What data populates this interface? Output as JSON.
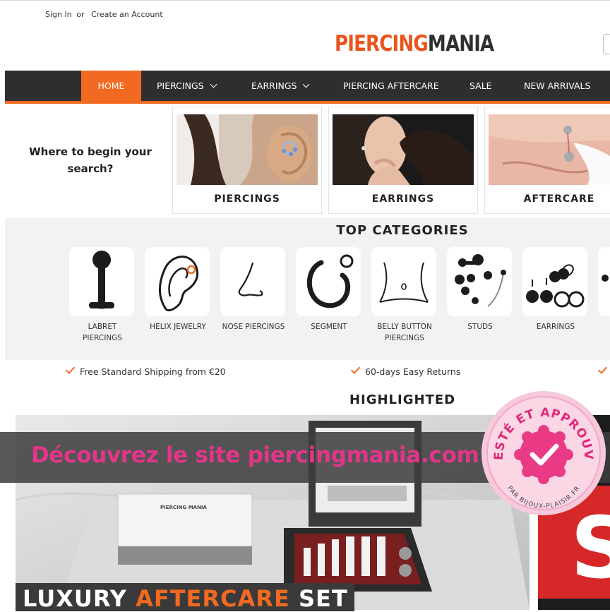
{
  "header": {
    "sign_in": "Sign In",
    "or": "or",
    "create_account": "Create an Account",
    "logo_part1": "PIERCING",
    "logo_part2": "MANIA"
  },
  "nav": {
    "items": [
      {
        "label": "HOME",
        "active": true,
        "dropdown": false
      },
      {
        "label": "PIERCINGS",
        "active": false,
        "dropdown": true
      },
      {
        "label": "EARRINGS",
        "active": false,
        "dropdown": true
      },
      {
        "label": "PIERCING AFTERCARE",
        "active": false,
        "dropdown": false
      },
      {
        "label": "SALE",
        "active": false,
        "dropdown": false
      },
      {
        "label": "NEW ARRIVALS",
        "active": false,
        "dropdown": false
      }
    ]
  },
  "begin": {
    "line1": "Where to begin your",
    "line2": "search?",
    "cards": [
      {
        "label": "PIERCINGS"
      },
      {
        "label": "EARRINGS"
      },
      {
        "label": "AFTERCARE"
      }
    ]
  },
  "top_categories": {
    "title": "TOP CATEGORIES",
    "items": [
      {
        "line1": "LABRET",
        "line2": "PIERCINGS",
        "icon": "labret-icon"
      },
      {
        "line1": "HELIX JEWELRY",
        "line2": "",
        "icon": "helix-ear-icon"
      },
      {
        "line1": "NOSE PIERCINGS",
        "line2": "",
        "icon": "nose-icon"
      },
      {
        "line1": "SEGMENT",
        "line2": "",
        "icon": "segment-ring-icon"
      },
      {
        "line1": "BELLY BUTTON",
        "line2": "PIERCINGS",
        "icon": "belly-icon"
      },
      {
        "line1": "STUDS",
        "line2": "",
        "icon": "studs-icon"
      },
      {
        "line1": "EARRINGS",
        "line2": "",
        "icon": "earrings-icon"
      }
    ]
  },
  "perks": [
    {
      "label": "Free Standard Shipping from €20"
    },
    {
      "label": "60-days Easy Returns"
    }
  ],
  "highlighted": {
    "title": "HIGHLIGHTED",
    "promo_word1": "LUXURY",
    "promo_word2": "AFTERCARE",
    "promo_word3": "SET",
    "box_logo": "PIERCING MANIA"
  },
  "overlay": {
    "text": "Découvrez le site piercingmania.com"
  },
  "badge": {
    "top_text": "TESTÉ ET APPROUVÉ",
    "bottom_text": "PAR BIJOUX-PLAISIR.FR"
  },
  "colors": {
    "accent": "#f26a21",
    "nav_bg": "#2e2e2e",
    "overlay_text": "#e3358a",
    "badge_pink": "#ea3a86"
  }
}
